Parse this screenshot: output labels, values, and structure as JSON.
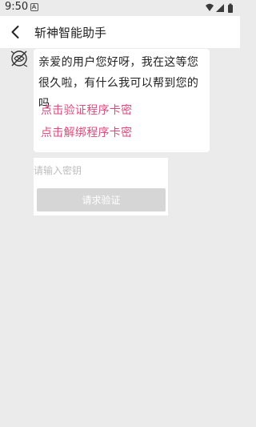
{
  "status_bar": {
    "time": "9:50",
    "notification_icon": "a-icon",
    "icons": [
      "wifi-icon",
      "signal-icon",
      "battery-icon"
    ]
  },
  "app_bar": {
    "title": "斩神智能助手",
    "back_icon": "back-arrow-icon"
  },
  "chat": {
    "avatar_icon": "bot-avatar-icon",
    "message": "亲爱的用户您好呀，我在这等您很久啦，有什么我可以帮到您的吗",
    "links": [
      {
        "label": "点击验证程序卡密"
      },
      {
        "label": "点击解绑程序卡密"
      }
    ]
  },
  "key_form": {
    "input_value": "",
    "placeholder": "请输入密钥",
    "submit_label": "请求验证"
  },
  "colors": {
    "background": "#ebebeb",
    "link": "#e8457a",
    "button_disabled": "#d6d6d6"
  }
}
